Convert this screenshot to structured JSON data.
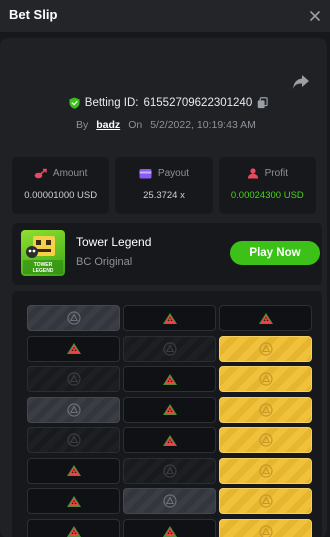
{
  "header": {
    "title": "Bet Slip"
  },
  "bet": {
    "id_label": "Betting ID:",
    "id_value": "61552709622301240",
    "by_label": "By",
    "username": "badz",
    "on_label": "On",
    "datetime": "5/2/2022, 10:19:43 AM"
  },
  "stats": {
    "amount_label": "Amount",
    "amount_value": "0.00001000 USD",
    "payout_label": "Payout",
    "payout_value": "25.3724 x",
    "profit_label": "Profit",
    "profit_value": "0.00024300 USD"
  },
  "game": {
    "name": "Tower Legend",
    "provider": "BC Original",
    "play_label": "Play Now",
    "thumb_text": "TOWER LEGEND"
  },
  "board": {
    "rows": [
      [
        "gray",
        "dark-melon",
        "dark-melon"
      ],
      [
        "dark-melon",
        "gray-faint",
        "gold"
      ],
      [
        "gray-faint",
        "dark-melon",
        "gold"
      ],
      [
        "gray",
        "dark-melon",
        "gold"
      ],
      [
        "gray-faint",
        "dark-melon",
        "gold"
      ],
      [
        "dark-melon",
        "gray-faint",
        "gold"
      ],
      [
        "dark-melon",
        "gray",
        "gold"
      ],
      [
        "dark-melon",
        "dark-melon",
        "gold"
      ]
    ]
  },
  "colors": {
    "accent_green": "#3bc117",
    "profit_green": "#4ad418",
    "amount_icon": "#e84a5f",
    "payout_icon": "#8a5cf6",
    "profit_icon": "#e84a5f",
    "gold": "#f0c23c"
  }
}
